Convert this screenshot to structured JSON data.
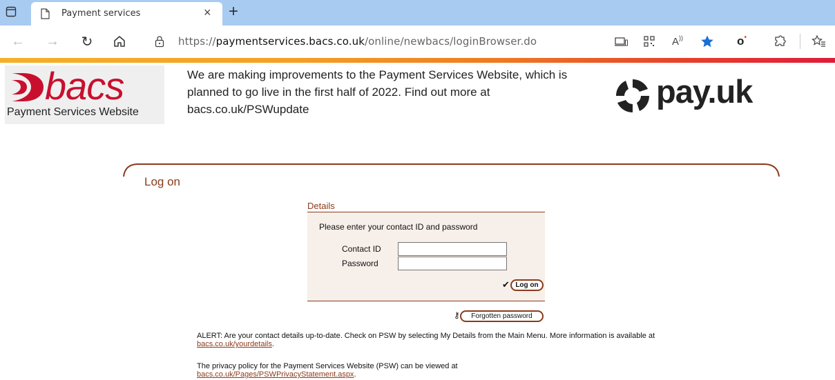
{
  "browser": {
    "tab_title": "Payment services",
    "url_prefix": "https://",
    "url_host": "paymentservices.bacs.co.uk",
    "url_path": "/online/newbacs/loginBrowser.do"
  },
  "header": {
    "logo_text": "bacs",
    "logo_subtitle": "Payment Services Website",
    "announcement": "We are making improvements to the Payment Services Website, which is planned to go live in the first half of 2022. Find out more at bacs.co.uk/PSWupdate",
    "partner_logo_text": "pay.uk"
  },
  "logon": {
    "heading": "Log on",
    "details_title": "Details",
    "instruction": "Please enter your contact ID and password",
    "contact_id_label": "Contact ID",
    "contact_id_value": "",
    "password_label": "Password",
    "password_value": "",
    "logon_button": "Log on",
    "forgotten_button": "Forgotten password"
  },
  "alert": {
    "text": "ALERT: Are your contact details up-to-date. Check on PSW by selecting My Details from the Main Menu. More information is available at",
    "link": "bacs.co.uk/yourdetails",
    "suffix": "."
  },
  "privacy": {
    "text": "The privacy policy for the Payment Services Website (PSW) can be viewed at",
    "link": "bacs.co.uk/Pages/PSWPrivacyStatement.aspx",
    "suffix": "."
  },
  "colors": {
    "brand_red": "#c8102e",
    "accent_brown": "#8b3a1a",
    "details_bg": "#f7efea",
    "tabbar_blue": "#a8cbf2"
  }
}
